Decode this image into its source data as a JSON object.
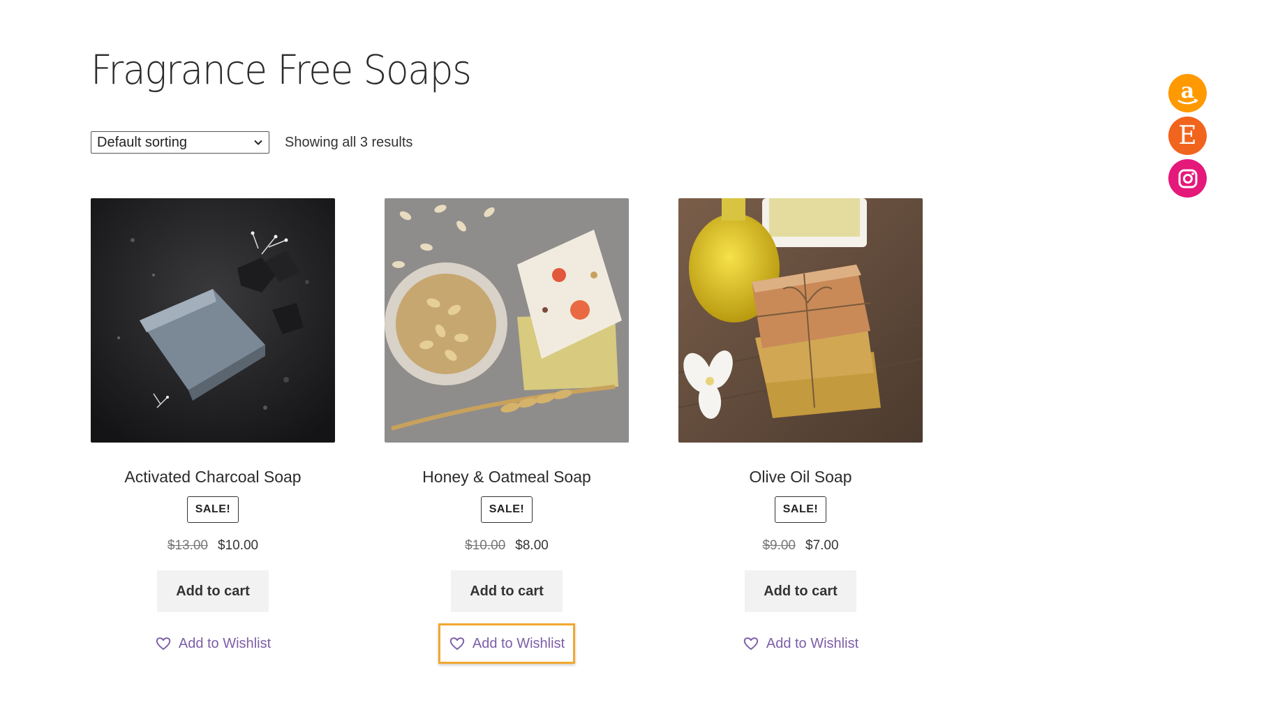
{
  "page": {
    "title": "Fragrance Free Soaps"
  },
  "toolbar": {
    "sort_selected": "Default sorting",
    "result_count": "Showing all 3 results"
  },
  "products": [
    {
      "name": "Activated Charcoal Soap",
      "badge": "SALE!",
      "old_price": "$13.00",
      "price": "$10.00",
      "cart_label": "Add to cart",
      "wishlist_label": "Add to Wishlist"
    },
    {
      "name": "Honey & Oatmeal Soap",
      "badge": "SALE!",
      "old_price": "$10.00",
      "price": "$8.00",
      "cart_label": "Add to cart",
      "wishlist_label": "Add to Wishlist"
    },
    {
      "name": "Olive Oil Soap",
      "badge": "SALE!",
      "old_price": "$9.00",
      "price": "$7.00",
      "cart_label": "Add to cart",
      "wishlist_label": "Add to Wishlist"
    }
  ],
  "social": {
    "amazon_glyph": "a",
    "etsy_glyph": "E",
    "colors": {
      "amazon": "#ff9900",
      "etsy": "#f1641e",
      "instagram": "#e4197a"
    },
    "icons": [
      "amazon-icon",
      "etsy-icon",
      "instagram-icon"
    ]
  },
  "colors": {
    "wishlist_link": "#7b5ea7",
    "focus_ring": "#f0a830",
    "cart_button_bg": "#f2f2f2"
  }
}
